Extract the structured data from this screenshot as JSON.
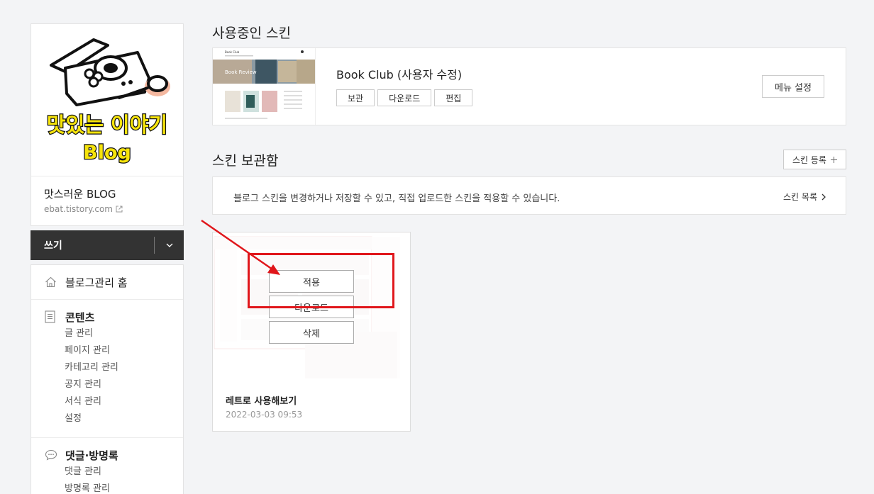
{
  "sidebar": {
    "logo_text": "맛있는 이야기",
    "logo_sub": "Blog",
    "blog_name": "맛스러운 BLOG",
    "blog_url": "ebat.tistory.com",
    "write_label": "쓰기",
    "home_label": "블로그관리 홈",
    "contents": {
      "title": "콘텐츠",
      "items": [
        "글 관리",
        "페이지 관리",
        "카테고리 관리",
        "공지 관리",
        "서식 관리",
        "설정"
      ]
    },
    "comments": {
      "title": "댓글·방명록",
      "items": [
        "댓글 관리",
        "방명록 관리"
      ]
    }
  },
  "current_skin": {
    "section_title": "사용중인 스킨",
    "name": "Book Club (사용자 수정)",
    "thumb_title": "Book Club",
    "thumb_banner": "Book Review",
    "buttons": [
      "보관",
      "다운로드",
      "편집"
    ],
    "menu_button": "메뉴 설정"
  },
  "storage": {
    "section_title": "스킨 보관함",
    "register_button": "스킨 등록",
    "info_text": "블로그 스킨을 변경하거나 저장할 수 있고, 직접 업로드한 스킨을 적용할 수 있습니다.",
    "list_link": "스킨 목록",
    "card": {
      "apply": "적용",
      "download": "다운로드",
      "delete": "삭제",
      "name": "레트로 사용해보기",
      "date": "2022-03-03 09:53"
    }
  },
  "colors": {
    "annotation": "#e0161b",
    "write_bar": "#333333"
  }
}
